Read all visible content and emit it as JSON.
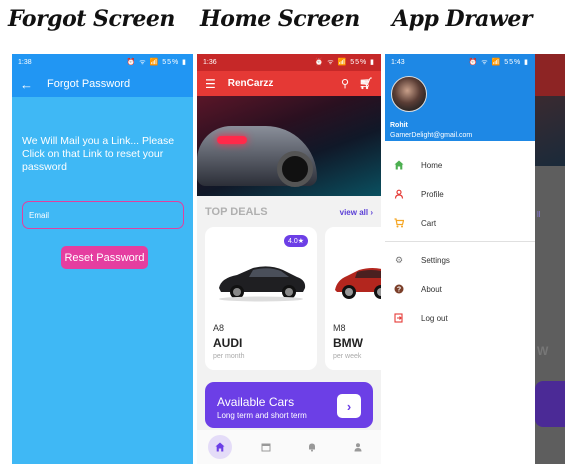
{
  "captions": {
    "forgot": "Forgot Screen",
    "home": "Home Screen",
    "drawer": "App Drawer"
  },
  "forgot_screen": {
    "status_time": "1:38",
    "status_right": "⏰ ᯤ 📶 55% ▮",
    "title": "Forgot Password",
    "message": "We Will Mail you a Link... Please Click on that Link to reset your password",
    "email_placeholder": "Email",
    "reset_button": "Reset Password"
  },
  "home_screen": {
    "status_time": "1:36",
    "status_right": "⏰ ᯤ 📶 55% ▮",
    "app_title": "RenCarzz",
    "deals_title": "TOP DEALS",
    "view_all": "view all",
    "cards": [
      {
        "rating": "4.0★",
        "model": "A8",
        "brand": "AUDI",
        "period": "per month"
      },
      {
        "model": "M8",
        "brand": "BMW",
        "period": "per week"
      }
    ],
    "available": {
      "title": "Available Cars",
      "subtitle": "Long term and short term",
      "arrow": "›"
    },
    "nav": [
      "home-icon",
      "calendar-icon",
      "bell-icon",
      "person-icon"
    ]
  },
  "drawer_screen": {
    "status_time": "1:43",
    "status_right": "⏰ ᯤ 📶 55% ▮",
    "user_name": "Rohit",
    "user_email": "GamerDelight@gmail.com",
    "items": [
      {
        "label": "Home",
        "icon": "home-icon",
        "color": "#4caf50"
      },
      {
        "label": "Profile",
        "icon": "person-icon",
        "color": "#e53935"
      },
      {
        "label": "Cart",
        "icon": "cart-icon",
        "color": "#f5a623"
      }
    ],
    "items2": [
      {
        "label": "Settings",
        "icon": "gear-icon",
        "color": "#757575"
      },
      {
        "label": "About",
        "icon": "help-icon",
        "color": "#7b3f2a"
      },
      {
        "label": "Log out",
        "icon": "logout-icon",
        "color": "#e53935"
      }
    ],
    "peek": {
      "view_all": "ll",
      "w_letter": "W"
    }
  },
  "colors": {
    "forgot_bg": "#3fb8f5",
    "forgot_bar": "#2196f3",
    "home_bar": "#e53935",
    "accent_purple": "#6c3fe6",
    "drawer_header": "#1e88e5",
    "reset_button": "#e53ea0"
  }
}
